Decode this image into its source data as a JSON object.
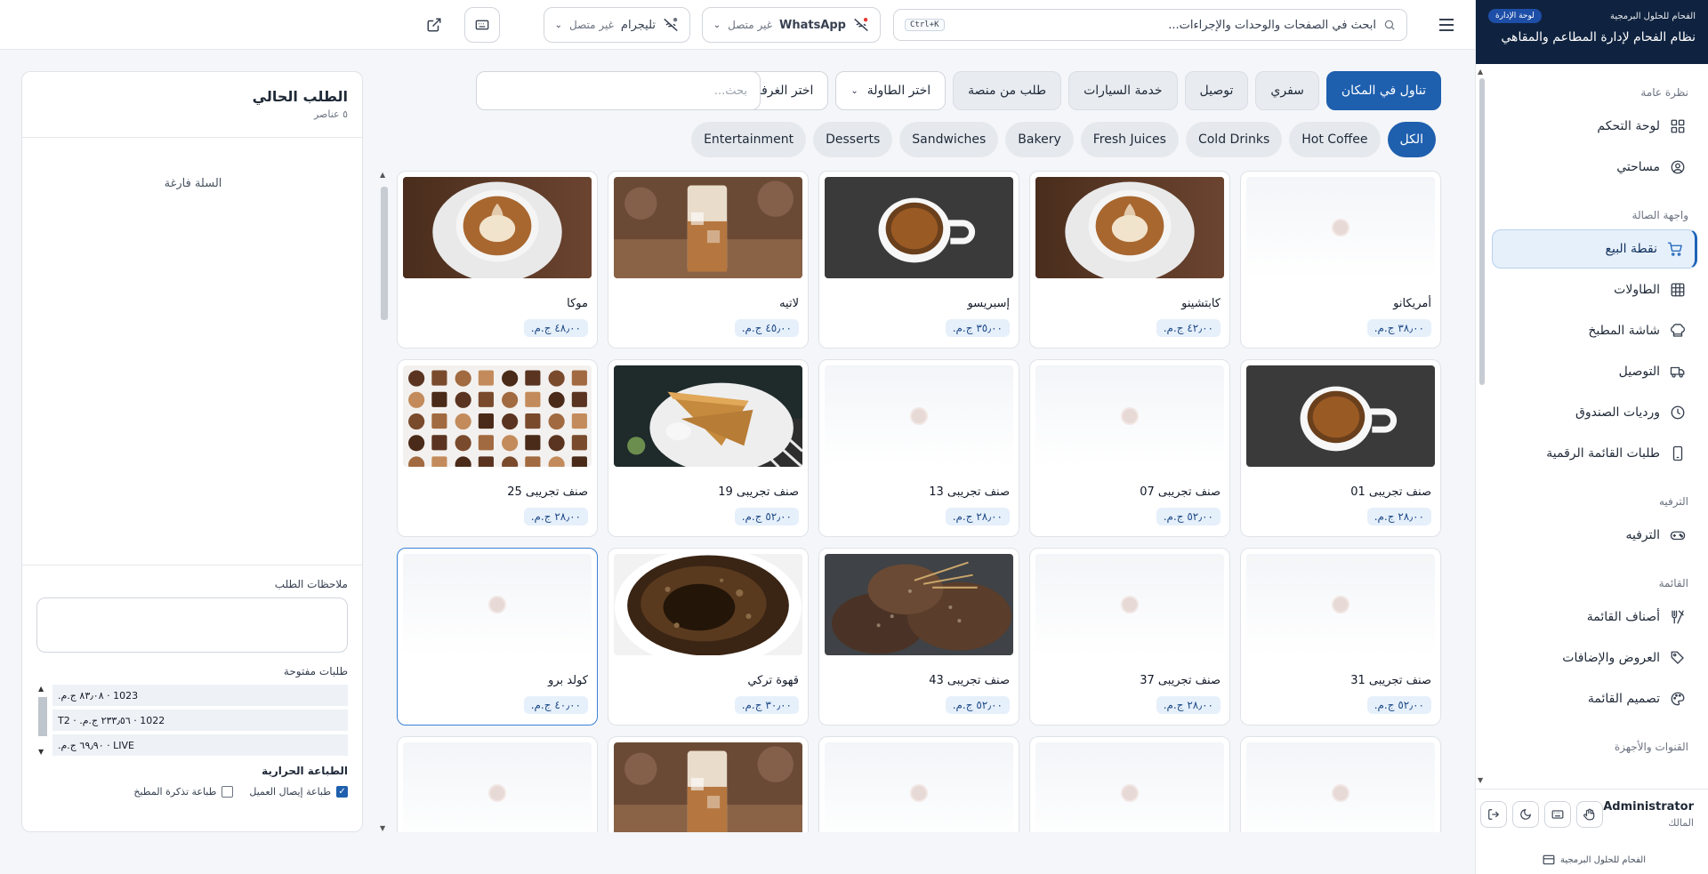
{
  "brand": {
    "company": "الفحام للحلول البرمجية",
    "badge": "لوحة الإدارة",
    "title": "نظام الفحام لإدارة المطاعم والمقاهي"
  },
  "sidebar": {
    "sections": [
      {
        "title": "نظرة عامة",
        "items": [
          {
            "label": "لوحة التحكم",
            "icon": "dashboard-icon"
          },
          {
            "label": "مساحتي",
            "icon": "user-circle-icon"
          }
        ]
      },
      {
        "title": "واجهة الصالة",
        "items": [
          {
            "label": "نقطة البيع",
            "icon": "cart-icon",
            "active": true
          },
          {
            "label": "الطاولات",
            "icon": "grid-icon"
          },
          {
            "label": "شاشة المطبخ",
            "icon": "chef-hat-icon"
          },
          {
            "label": "التوصيل",
            "icon": "truck-icon"
          },
          {
            "label": "وردیات الصندوق",
            "icon": "clock-icon"
          },
          {
            "label": "طلبات القائمة الرقمية",
            "icon": "phone-icon"
          }
        ]
      },
      {
        "title": "الترفيه",
        "items": [
          {
            "label": "الترفيه",
            "icon": "gamepad-icon"
          }
        ]
      },
      {
        "title": "القائمة",
        "items": [
          {
            "label": "أصناف القائمة",
            "icon": "utensils-icon"
          },
          {
            "label": "العروض والإضافات",
            "icon": "tag-icon"
          },
          {
            "label": "تصميم القائمة",
            "icon": "palette-icon"
          }
        ]
      },
      {
        "title": "القنوات والأجهزة",
        "items": []
      }
    ],
    "user": {
      "name": "Administrator",
      "role": "المالك"
    },
    "footer": "الفحام للحلول البرمجية"
  },
  "topbar": {
    "search_placeholder": "ابحث في الصفحات والوحدات والإجراءات...",
    "shortcut": "Ctrl+K",
    "whatsapp": {
      "label": "WhatsApp",
      "status": "غير متصل"
    },
    "telegram": {
      "label": "تليجرام",
      "status": "غير متصل"
    }
  },
  "order_types": {
    "dine_in": "تناول في المكان",
    "takeaway": "سفري",
    "delivery": "توصيل",
    "car_service": "خدمة السيارات",
    "platform": "طلب من منصة",
    "table_select": "اختر الطاولة",
    "room_select": "اختر الغرفة / الجلسة",
    "search_placeholder": "بحث..."
  },
  "categories": [
    "الكل",
    "Hot Coffee",
    "Cold Drinks",
    "Fresh Juices",
    "Bakery",
    "Sandwiches",
    "Desserts",
    "Entertainment"
  ],
  "products": [
    {
      "name": "أمريكانو",
      "price": "٣٨٫٠٠ ج.م.",
      "image": "empty"
    },
    {
      "name": "كابتشينو",
      "price": "٤٢٫٠٠ ج.م.",
      "image": "latte-art"
    },
    {
      "name": "إسبريسو",
      "price": "٣٥٫٠٠ ج.م.",
      "image": "espresso"
    },
    {
      "name": "لاتيه",
      "price": "٤٥٫٠٠ ج.م.",
      "image": "iced-latte"
    },
    {
      "name": "موكا",
      "price": "٤٨٫٠٠ ج.م.",
      "image": "latte-art"
    },
    {
      "name": "صنف تجريبى 01",
      "price": "٢٨٫٠٠ ج.م.",
      "image": "espresso"
    },
    {
      "name": "صنف تجريبى 07",
      "price": "٥٢٫٠٠ ج.م.",
      "image": "empty"
    },
    {
      "name": "صنف تجريبى 13",
      "price": "٢٨٫٠٠ ج.م.",
      "image": "empty"
    },
    {
      "name": "صنف تجريبى 19",
      "price": "٥٢٫٠٠ ج.م.",
      "image": "sandwich"
    },
    {
      "name": "صنف تجريبى 25",
      "price": "٢٨٫٠٠ ج.م.",
      "image": "chocolates"
    },
    {
      "name": "صنف تجريبى 31",
      "price": "٥٢٫٠٠ ج.م.",
      "image": "empty"
    },
    {
      "name": "صنف تجريبى 37",
      "price": "٢٨٫٠٠ ج.م.",
      "image": "empty"
    },
    {
      "name": "صنف تجريبى 43",
      "price": "٥٢٫٠٠ ج.م.",
      "image": "bread"
    },
    {
      "name": "قهوة تركي",
      "price": "٣٠٫٠٠ ج.م.",
      "image": "turkish-coffee"
    },
    {
      "name": "كولد برو",
      "price": "٤٠٫٠٠ ج.م.",
      "image": "empty",
      "selected": true
    },
    {
      "name": "",
      "price": "",
      "image": "empty"
    },
    {
      "name": "",
      "price": "",
      "image": "empty"
    },
    {
      "name": "",
      "price": "",
      "image": "empty"
    },
    {
      "name": "",
      "price": "",
      "image": "iced-latte"
    },
    {
      "name": "",
      "price": "",
      "image": "empty"
    }
  ],
  "cart": {
    "title": "الطلب الحالي",
    "count": "٥ عناصر",
    "empty": "السلة فارغة",
    "notes_label": "ملاحظات الطلب",
    "open_orders_label": "طلبات مفتوحة",
    "open_orders": [
      "1023 · ٨٣٫٠٨ ج.م.",
      "1022 · ٢٣٣٫٥٦ ج.م. · T2",
      "LIVE · ٦٩٫٩٠ ج.م."
    ],
    "printer_title": "الطباعة الحرارية",
    "print_receipt": "طباعة إيصال العميل",
    "print_kitchen": "طباعة تذكرة المطبخ"
  },
  "colors": {
    "primary": "#1e5fae",
    "brand_bg": "#0f2340",
    "active_bg": "#e6f0fb"
  }
}
